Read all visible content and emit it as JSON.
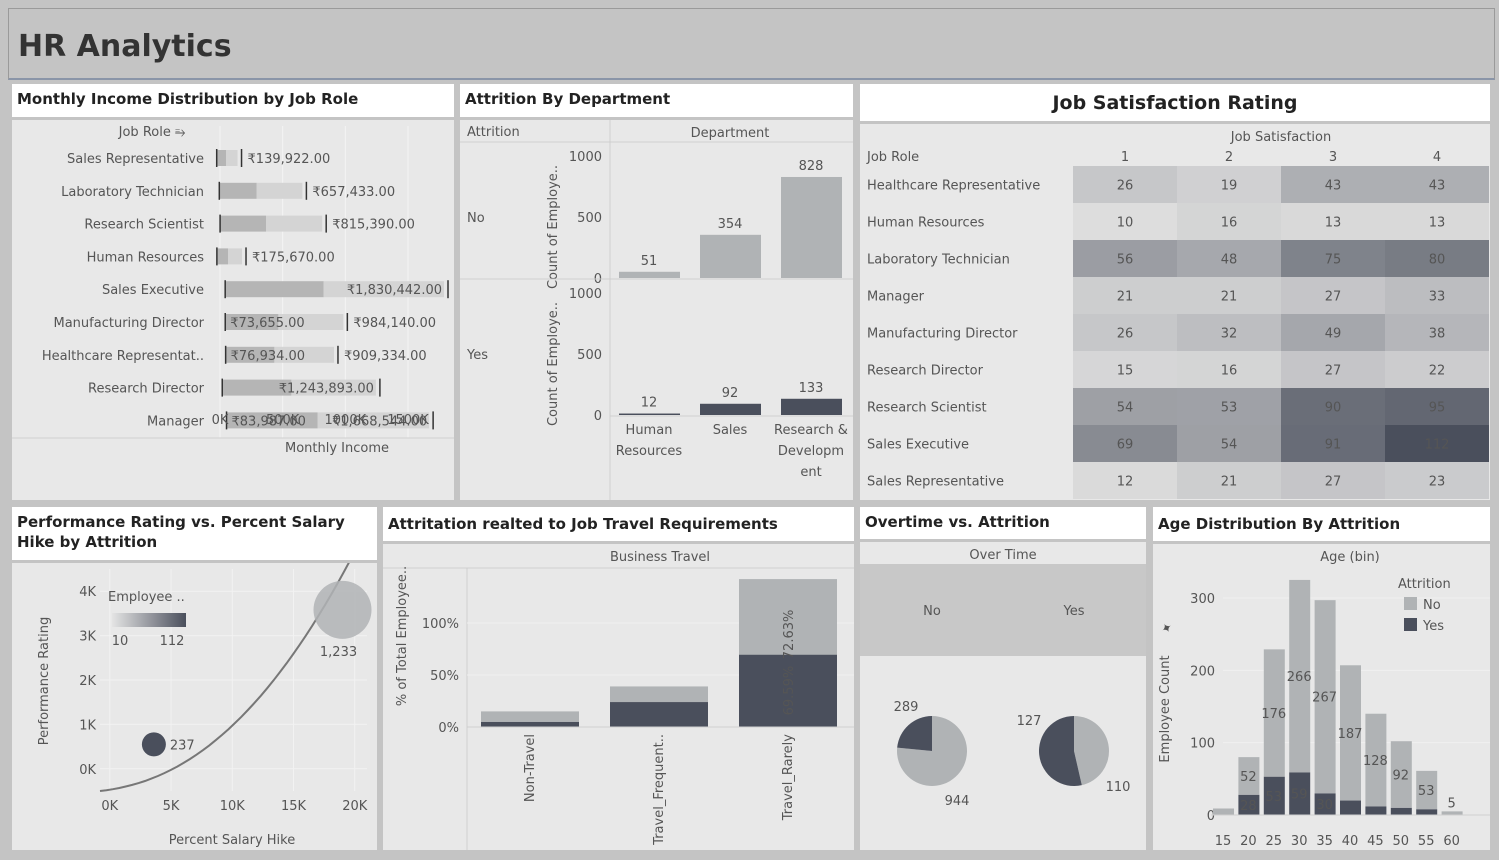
{
  "header": {
    "title": "HR Analytics"
  },
  "panels": {
    "income": {
      "title": "Monthly Income Distribution by Job Role"
    },
    "attrition_dept": {
      "title": "Attrition By Department"
    },
    "job_sat": {
      "title": "Job Satisfaction Rating"
    },
    "perf": {
      "title": "Performance Rating vs. Percent Salary Hike by Attrition"
    },
    "travel": {
      "title": "Attritation realted to Job Travel Requirements"
    },
    "overtime": {
      "title": "Overtime vs. Attrition"
    },
    "age": {
      "title": "Age Distribution By Attrition"
    }
  },
  "colors": {
    "dark": "#4a4f5c",
    "light": "#b0b3b5",
    "mid": "#8a8d90"
  },
  "chart_data": [
    {
      "id": "income",
      "type": "bar",
      "row_header": "Job Role",
      "xlabel": "Monthly Income",
      "xticks": [
        "0K",
        "500K",
        "1000K",
        "1500K"
      ],
      "xlim": [
        0,
        1700000
      ],
      "categories": [
        "Sales Representative",
        "Laboratory Technician",
        "Research Scientist",
        "Human Resources",
        "Sales Executive",
        "Manufacturing Director",
        "Healthcare Representat..",
        "Research Director",
        "Manager"
      ],
      "series": [
        {
          "values": [
            null,
            null,
            null,
            null,
            null,
            73655,
            76934,
            null,
            83987
          ],
          "labels": [
            "",
            "",
            "",
            "",
            "",
            "₹73,655.00",
            "₹76,934.00",
            "",
            "₹83,987.00"
          ]
        },
        {
          "values": [
            139922,
            657433,
            815390,
            175670,
            1830442,
            984140,
            909334,
            1243893,
            1668544
          ],
          "labels": [
            "₹139,922.00",
            "₹657,433.00",
            "₹815,390.00",
            "₹175,670.00",
            "₹1,830,442.00",
            "₹984,140.00",
            "₹909,334.00",
            "₹1,243,893.00",
            "₹1,668,544.00"
          ]
        }
      ]
    },
    {
      "id": "attrition_dept",
      "type": "bar",
      "row_header": "Attrition",
      "col_header": "Department",
      "ylabel": "Count of Employe..",
      "ylim": [
        0,
        1000
      ],
      "yticks": [
        0,
        500,
        1000
      ],
      "categories": [
        "Human Resources",
        "Sales",
        "Research & Development"
      ],
      "category_labels": [
        [
          "Human",
          "Resources"
        ],
        [
          "Sales"
        ],
        [
          "Research &",
          "Developm",
          "ent"
        ]
      ],
      "series": [
        {
          "name": "No",
          "values": [
            51,
            354,
            828
          ]
        },
        {
          "name": "Yes",
          "values": [
            12,
            92,
            133
          ]
        }
      ]
    },
    {
      "id": "job_sat",
      "type": "heatmap",
      "col_header": "Job Satisfaction",
      "row_header": "Job Role",
      "columns": [
        "1",
        "2",
        "3",
        "4"
      ],
      "rows": [
        "Healthcare Representative",
        "Human Resources",
        "Laboratory Technician",
        "Manager",
        "Manufacturing Director",
        "Research Director",
        "Research Scientist",
        "Sales Executive",
        "Sales Representative"
      ],
      "values": [
        [
          26,
          19,
          43,
          43
        ],
        [
          10,
          16,
          13,
          13
        ],
        [
          56,
          48,
          75,
          80
        ],
        [
          21,
          21,
          27,
          33
        ],
        [
          26,
          32,
          49,
          38
        ],
        [
          15,
          16,
          27,
          22
        ],
        [
          54,
          53,
          90,
          95
        ],
        [
          69,
          54,
          91,
          112
        ],
        [
          12,
          21,
          27,
          23
        ]
      ]
    },
    {
      "id": "perf",
      "type": "scatter",
      "xlabel": "Percent Salary Hike",
      "ylabel": "Performance Rating",
      "xticks": [
        "0K",
        "5K",
        "10K",
        "15K",
        "20K"
      ],
      "yticks": [
        "0K",
        "1K",
        "2K",
        "3K",
        "4K"
      ],
      "xlim": [
        -800,
        21000
      ],
      "ylim": [
        -500,
        4500
      ],
      "legend_title": "Employee ..",
      "legend_range": [
        "10",
        "112"
      ],
      "points": [
        {
          "x": 3600,
          "y": 550,
          "label": "237",
          "color": "#4a4f5c"
        },
        {
          "x": 19000,
          "y": 3580,
          "label": "1,233",
          "color": "#b0b3b5"
        }
      ]
    },
    {
      "id": "travel",
      "type": "bar",
      "col_header": "Business Travel",
      "ylabel": "% of Total Employee..",
      "yticks": [
        "0%",
        "50%",
        "100%"
      ],
      "categories": [
        "Non-Travel",
        "Travel_Frequent..",
        "Travel_Rarely"
      ],
      "series": [
        {
          "name": "Yes",
          "values": [
            5,
            24,
            69.59
          ]
        },
        {
          "name": "No",
          "values": [
            10,
            15,
            72.63
          ]
        }
      ],
      "labels": [
        "72.63%",
        "69.59%"
      ]
    },
    {
      "id": "overtime",
      "type": "pie",
      "col_header": "Over Time",
      "categories": [
        "No",
        "Yes"
      ],
      "series": [
        {
          "name": "No",
          "values": [
            944,
            289
          ]
        },
        {
          "name": "Yes",
          "values": [
            110,
            127
          ]
        }
      ]
    },
    {
      "id": "age",
      "type": "bar",
      "xlabel": "Age (bin)",
      "ylabel": "Employee Count",
      "ylim": [
        0,
        330
      ],
      "yticks": [
        0,
        100,
        200,
        300
      ],
      "legend_title": "Attrition",
      "categories": [
        "15",
        "20",
        "25",
        "30",
        "35",
        "40",
        "45",
        "50",
        "55",
        "60"
      ],
      "series": [
        {
          "name": "Yes",
          "values": [
            0,
            28,
            53,
            59,
            30,
            20,
            12,
            10,
            8,
            0
          ],
          "labels": [
            "",
            "28",
            "53",
            "59",
            "30",
            "",
            "",
            "",
            "",
            ""
          ]
        },
        {
          "name": "No",
          "values": [
            9,
            52,
            176,
            266,
            267,
            187,
            128,
            92,
            53,
            5
          ],
          "labels": [
            "",
            "52",
            "176",
            "266",
            "267",
            "187",
            "128",
            "92",
            "53",
            "5"
          ]
        }
      ]
    }
  ]
}
